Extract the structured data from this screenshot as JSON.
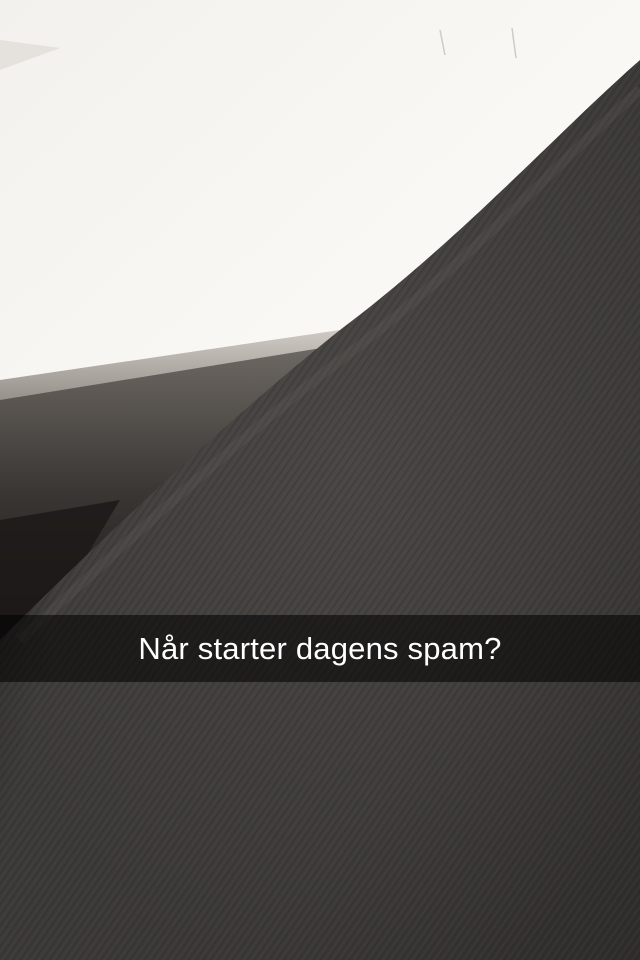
{
  "snap": {
    "caption": "Når starter dagens spam?"
  },
  "colors": {
    "paper": "#f6f4f0",
    "fabric": "#3b3937",
    "shadow": "#151312",
    "caption_bar": "#000000",
    "caption_text": "#ffffff"
  }
}
